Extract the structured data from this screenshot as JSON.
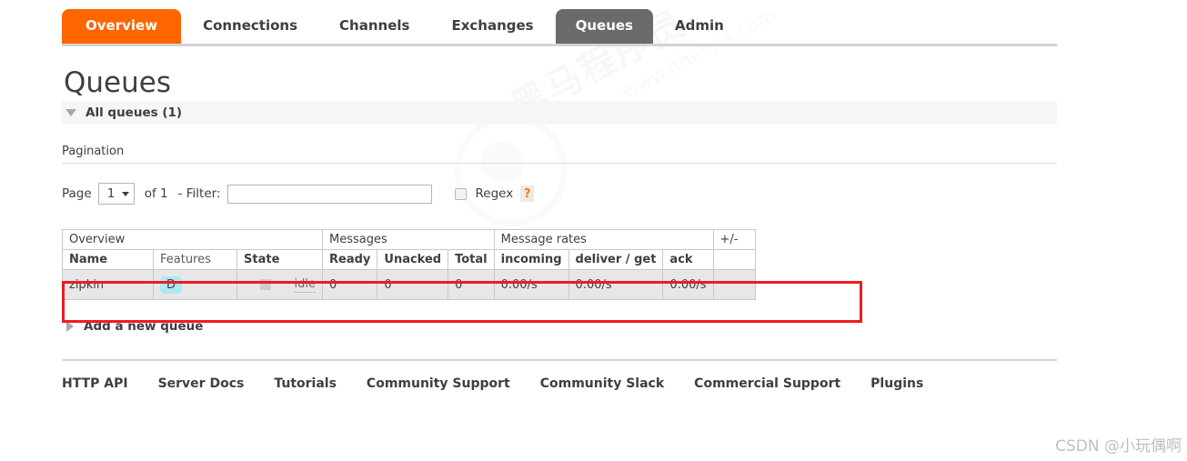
{
  "nav": {
    "tabs": [
      {
        "label": "Overview",
        "state": "orange"
      },
      {
        "label": "Connections",
        "state": "plain"
      },
      {
        "label": "Channels",
        "state": "plain"
      },
      {
        "label": "Exchanges",
        "state": "plain"
      },
      {
        "label": "Queues",
        "state": "gray"
      },
      {
        "label": "Admin",
        "state": "plain"
      }
    ]
  },
  "page": {
    "title": "Queues",
    "all_queues_label": "All queues (1)"
  },
  "pagination": {
    "label": "Pagination",
    "page_word": "Page",
    "page_value": "1",
    "of_text": "of 1",
    "filter_label": "- Filter:",
    "filter_value": "",
    "filter_placeholder": "",
    "regex_label": "Regex",
    "help_label": "?"
  },
  "table": {
    "group_headers": {
      "overview": "Overview",
      "messages": "Messages",
      "message_rates": "Message rates",
      "plusminus": "+/-"
    },
    "columns": {
      "name": "Name",
      "features": "Features",
      "state": "State",
      "ready": "Ready",
      "unacked": "Unacked",
      "total": "Total",
      "incoming": "incoming",
      "deliver_get": "deliver / get",
      "ack": "ack"
    },
    "rows": [
      {
        "name": "zipkin",
        "features": "D",
        "state": "idle",
        "ready": "0",
        "unacked": "0",
        "total": "0",
        "incoming": "0.00/s",
        "deliver_get": "0.00/s",
        "ack": "0.00/s"
      }
    ]
  },
  "add_queue": {
    "label": "Add a new queue"
  },
  "footer": {
    "links": [
      "HTTP API",
      "Server Docs",
      "Tutorials",
      "Community Support",
      "Community Slack",
      "Commercial Support",
      "Plugins"
    ]
  },
  "watermarks": {
    "brand_text": "黑马程序员",
    "brand_url": "www.itheima.com",
    "csdn": "CSDN @小玩偶啊"
  },
  "colors": {
    "accent_orange": "#ff6600",
    "active_tab_gray": "#6a6a6a",
    "annotation_red": "#ee1b24",
    "feature_badge_blue": "#aee7f5",
    "row_gray": "#e7e7e7"
  }
}
